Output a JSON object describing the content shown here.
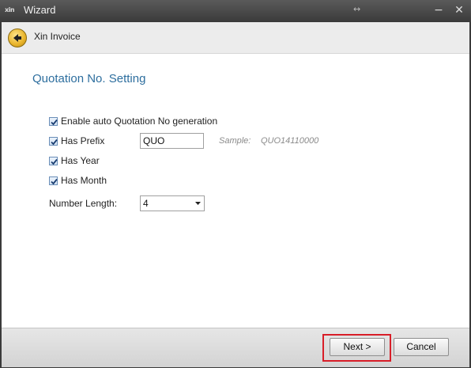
{
  "window": {
    "app_icon": "xin",
    "title": "Wizard",
    "resize_glyph": "↔",
    "minimize": "−",
    "close": "✕"
  },
  "header": {
    "title": "Xin Invoice",
    "back_icon": "back-arrow-icon",
    "accent": "#e8b32a"
  },
  "page": {
    "title": "Quotation No. Setting",
    "title_color": "#2d6e9e",
    "options": [
      {
        "label": "Enable auto Quotation No generation",
        "checked": true
      },
      {
        "label": "Has Prefix",
        "checked": true
      },
      {
        "label": "Has Year",
        "checked": true
      },
      {
        "label": "Has Month",
        "checked": true
      }
    ],
    "prefix_value": "QUO",
    "sample_label": "Sample:",
    "sample_value": "QUO14110000",
    "number_length_label": "Number Length:",
    "number_length_value": "4"
  },
  "footer": {
    "next_label": "Next >",
    "cancel_label": "Cancel",
    "highlight_color": "#d81e28"
  }
}
